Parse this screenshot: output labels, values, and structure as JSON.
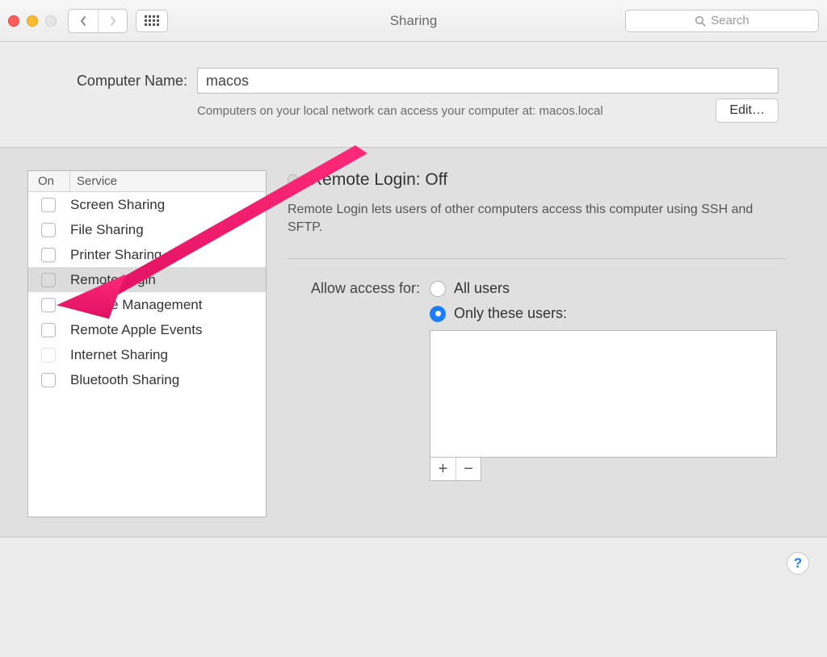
{
  "toolbar": {
    "title": "Sharing",
    "search_placeholder": "Search"
  },
  "header": {
    "computer_name_label": "Computer Name:",
    "computer_name_value": "macos",
    "description": "Computers on your local network can access your computer at: macos.local",
    "edit_label": "Edit…"
  },
  "services": {
    "col_on": "On",
    "col_service": "Service",
    "items": [
      {
        "label": "Screen Sharing",
        "checked": false,
        "selected": false,
        "disabled": false
      },
      {
        "label": "File Sharing",
        "checked": false,
        "selected": false,
        "disabled": false
      },
      {
        "label": "Printer Sharing",
        "checked": false,
        "selected": false,
        "disabled": false
      },
      {
        "label": "Remote Login",
        "checked": false,
        "selected": true,
        "disabled": false
      },
      {
        "label": "Remote Management",
        "checked": false,
        "selected": false,
        "disabled": false
      },
      {
        "label": "Remote Apple Events",
        "checked": false,
        "selected": false,
        "disabled": false
      },
      {
        "label": "Internet Sharing",
        "checked": false,
        "selected": false,
        "disabled": true
      },
      {
        "label": "Bluetooth Sharing",
        "checked": false,
        "selected": false,
        "disabled": false
      }
    ]
  },
  "detail": {
    "status": "Remote Login: Off",
    "description": "Remote Login lets users of other computers access this computer using SSH and SFTP.",
    "allow_label": "Allow access for:",
    "option_all": "All users",
    "option_only": "Only these users:",
    "selected_option": "only",
    "plus": "+",
    "minus": "−"
  },
  "help": "?"
}
